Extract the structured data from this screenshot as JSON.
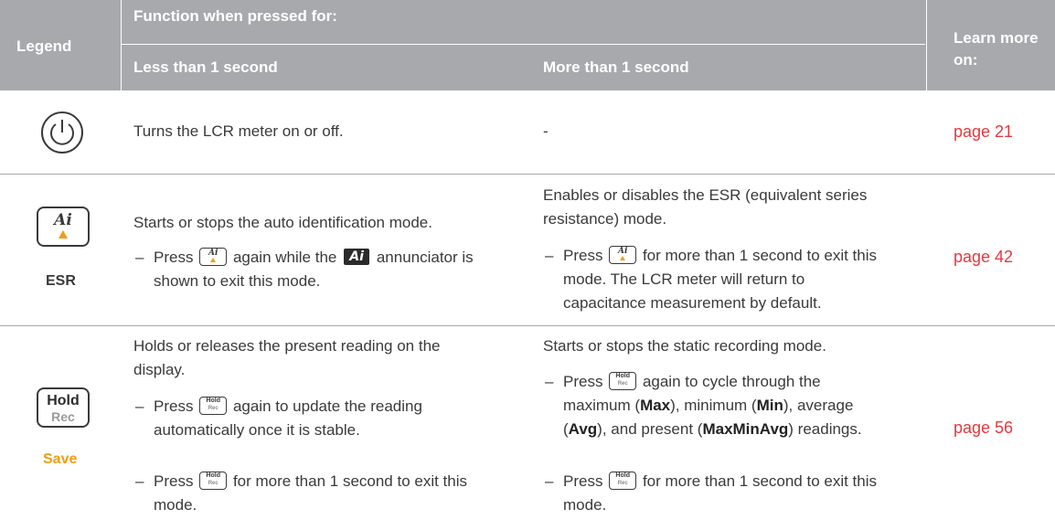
{
  "header": {
    "legend": "Legend",
    "function_when_pressed": "Function when pressed for:",
    "less_than": "Less than 1 second",
    "more_than": "More than 1 second",
    "learn_more_1": "Learn more",
    "learn_more_2": "on:"
  },
  "rows": [
    {
      "legend_icon": "power-icon",
      "less": "Turns the LCR meter on or off.",
      "more": "-",
      "link": "page 21"
    },
    {
      "legend_icon": "ai-key-icon",
      "legend_key_text": "Ai",
      "legend_sub": "ESR",
      "less_main": "Starts or stops the auto identification mode.",
      "less_sub_a": "Press",
      "less_sub_b": "again while the",
      "less_sub_annun": "Ai",
      "less_sub_c": "annunciator is",
      "less_sub_d": "shown to exit this mode.",
      "more_main_1": "Enables or disables the ESR (equivalent series",
      "more_main_2": "resistance) mode.",
      "more_sub_a": "Press",
      "more_sub_b": "for more than 1 second to exit this",
      "more_sub_c": "mode. The LCR meter will return to",
      "more_sub_d": "capacitance measurement by default.",
      "link": "page 42"
    },
    {
      "legend_icon": "hold-key-icon",
      "legend_key_text": "Hold",
      "legend_key_sub": "Rec",
      "legend_sub": "Save",
      "less_main_1": "Holds or releases the present reading on the",
      "less_main_2": "display.",
      "less_sub1_a": "Press",
      "less_sub1_b": "again to update the reading",
      "less_sub1_c": "automatically once it is stable.",
      "less_sub2_a": "Press",
      "less_sub2_b": "for more than 1 second to exit this",
      "less_sub2_c": "mode.",
      "more_main": "Starts or stops the static recording mode.",
      "more_sub1_a": "Press",
      "more_sub1_b": "again to cycle through the",
      "more_sub1_c1": "maximum (",
      "more_sub1_max": "Max",
      "more_sub1_c2": "), minimum (",
      "more_sub1_min": "Min",
      "more_sub1_c3": "), average",
      "more_sub1_d1": "(",
      "more_sub1_avg": "Avg",
      "more_sub1_d2": "), and present (",
      "more_sub1_mma": "MaxMinAvg",
      "more_sub1_d3": ") readings.",
      "more_sub2_a": "Press",
      "more_sub2_b": "for more than 1 second to exit this",
      "more_sub2_c": "mode.",
      "link": "page 56"
    }
  ],
  "mini_key": {
    "hold": "Hold",
    "rec": "Rec",
    "ai": "Ai"
  },
  "colors": {
    "header": "#a7a9ac",
    "link": "#e8383d",
    "accent": "#f39c12"
  }
}
